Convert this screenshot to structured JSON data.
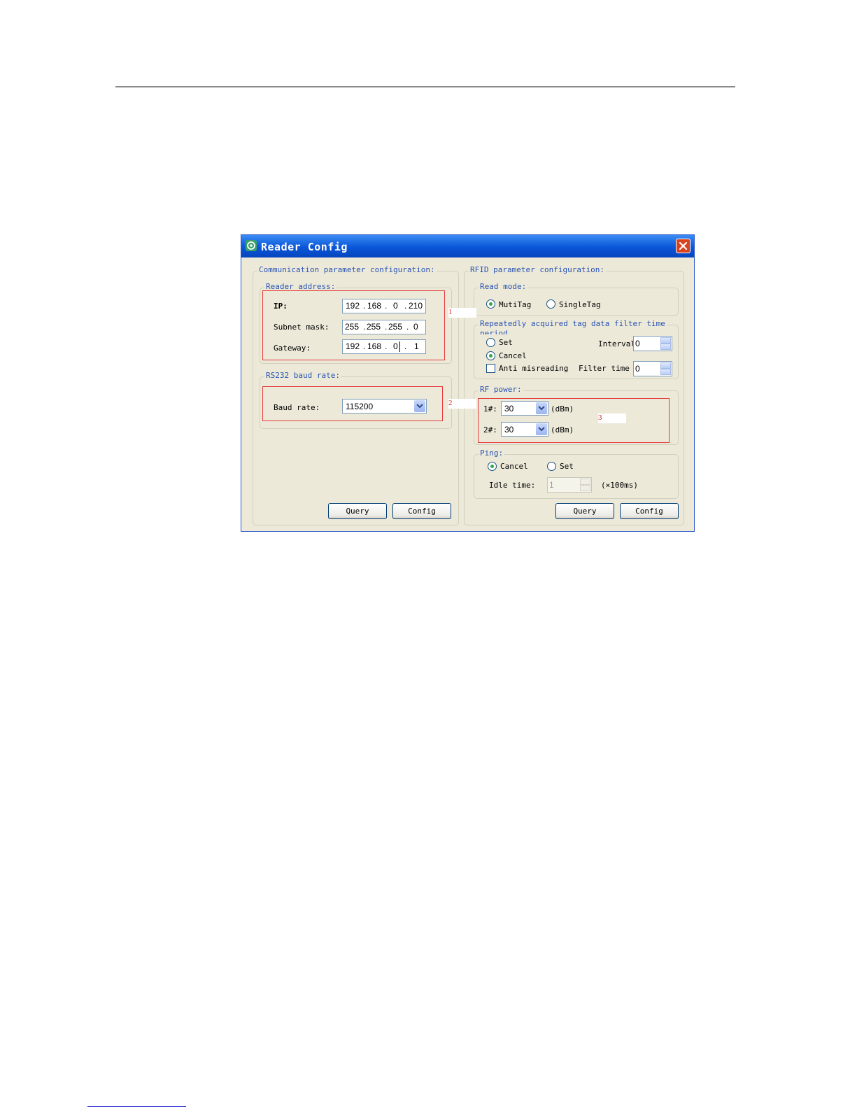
{
  "window": {
    "title": "Reader Config",
    "close_icon": "close-icon",
    "app_icon": "app-icon"
  },
  "comm": {
    "title": "Communication parameter configuration:",
    "reader_address": {
      "title": "Reader address:",
      "ip_label": "IP:",
      "ip": [
        "192",
        "168",
        "0",
        "210"
      ],
      "subnet_label": "Subnet mask:",
      "subnet": [
        "255",
        "255",
        "255",
        "0"
      ],
      "gateway_label": "Gateway:",
      "gateway": [
        "192",
        "168",
        "0",
        "1"
      ]
    },
    "rs232": {
      "title": "RS232 baud rate:",
      "baud_label": "Baud rate:",
      "baud_value": "115200"
    },
    "query_label": "Query",
    "config_label": "Config"
  },
  "rfid": {
    "title": "RFID parameter configuration:",
    "read_mode": {
      "title": "Read mode:",
      "option1": "MutiTag",
      "option2": "SingleTag",
      "selected": "MutiTag"
    },
    "filter": {
      "title_line1": "Repeatedly acquired tag data filter time",
      "title_line2": "period",
      "set_label": "Set",
      "cancel_label": "Cancel",
      "selected": "Cancel",
      "interval_label": "Interval",
      "interval_value": "0",
      "anti_label": "Anti misreading",
      "anti_checked": false,
      "filter_time_label": "Filter time",
      "filter_time_value": "0"
    },
    "rf_power": {
      "title": "RF power:",
      "p1_label": "1#:",
      "p1_value": "30",
      "p2_label": "2#:",
      "p2_value": "30",
      "unit": "(dBm)"
    },
    "ping": {
      "title": "Ping:",
      "cancel_label": "Cancel",
      "set_label": "Set",
      "selected": "Cancel",
      "idle_label": "Idle time:",
      "idle_value": "1",
      "idle_unit": "(×100ms)"
    },
    "query_label": "Query",
    "config_label": "Config"
  },
  "callouts": [
    "1",
    "2",
    "3"
  ],
  "colors": {
    "annotation": "#e53b3b",
    "titlebar": "#0a56d8",
    "group_label": "#2852b4"
  }
}
